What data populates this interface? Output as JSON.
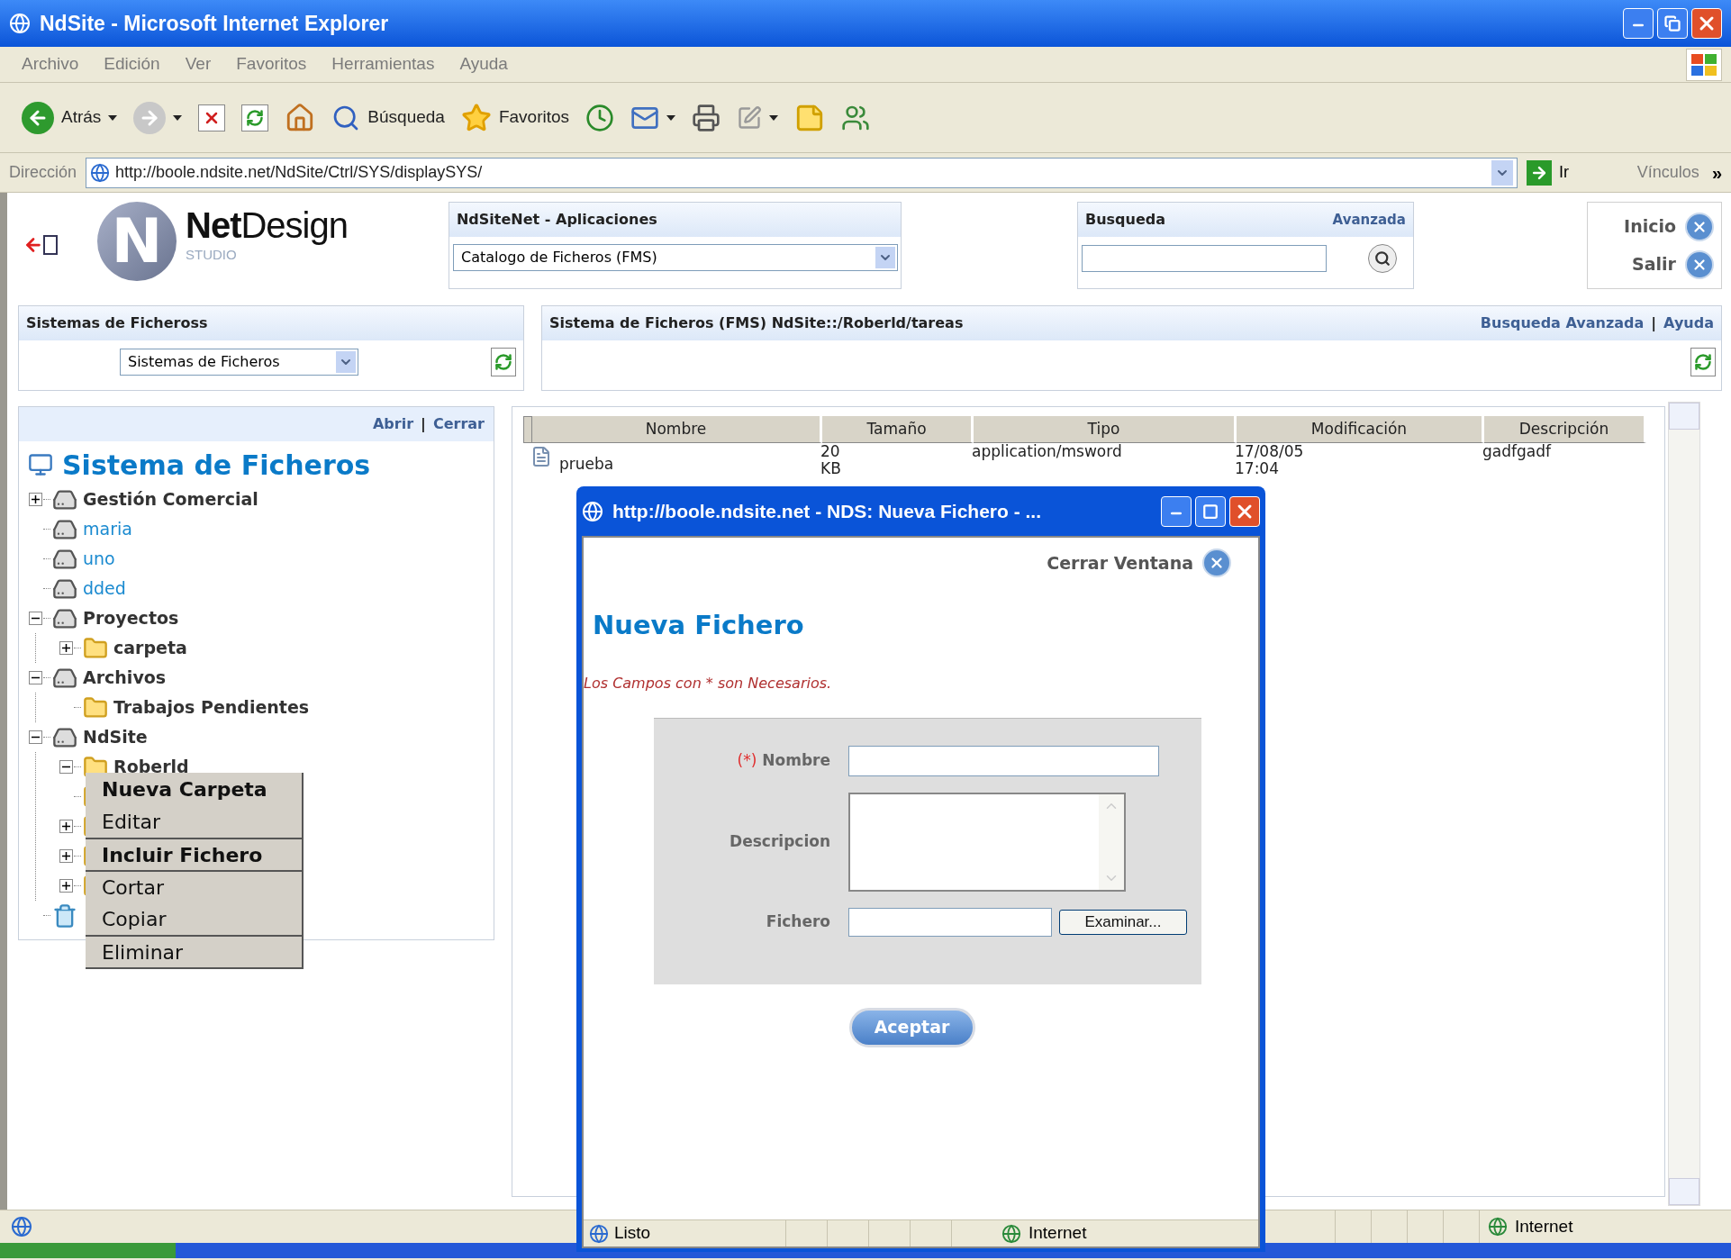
{
  "window": {
    "title": "NdSite - Microsoft Internet Explorer"
  },
  "menu_bar": [
    "Archivo",
    "Edición",
    "Ver",
    "Favoritos",
    "Herramientas",
    "Ayuda"
  ],
  "toolbar": [
    {
      "kind": "back",
      "label": "Atrás",
      "dropdown": true
    },
    {
      "kind": "forward",
      "dropdown": true
    },
    {
      "kind": "stop"
    },
    {
      "kind": "refresh"
    },
    {
      "kind": "home"
    },
    {
      "kind": "search",
      "label": "Búsqueda"
    },
    {
      "kind": "favorites",
      "label": "Favoritos"
    },
    {
      "kind": "history"
    },
    {
      "kind": "mail",
      "dropdown": true
    },
    {
      "kind": "print"
    },
    {
      "kind": "edit",
      "dropdown": true
    },
    {
      "kind": "notes"
    },
    {
      "kind": "messenger"
    }
  ],
  "address_bar": {
    "label": "Dirección",
    "url": "http://boole.ndsite.net/NdSite/Ctrl/SYS/displaySYS/",
    "go": "Ir",
    "links": "Vínculos",
    "more": "»"
  },
  "header": {
    "logo": {
      "mark": "N",
      "name": "**Net**Design",
      "tagline": "STUDIO"
    },
    "applications": {
      "title": "NdSiteNet - Aplicaciones",
      "value": "Catalogo de Ficheros (FMS)"
    },
    "search": {
      "title": "Busqueda",
      "link": "Avanzada"
    },
    "nav": [
      "Inicio",
      "Salir"
    ]
  },
  "filesystems_panel": {
    "title": "Sistemas de Ficheross",
    "value": "Sistemas de Ficheros"
  },
  "path_panel": {
    "title": "Sistema de Ficheros (FMS) NdSite::/Roberld/tareas",
    "links": [
      "Busqueda Avanzada",
      "Ayuda"
    ],
    "link_separator": "|"
  },
  "tree": {
    "links": [
      "Abrir",
      "Cerrar"
    ],
    "link_separator": "|",
    "heading": "Sistema de Ficheros",
    "nodes": [
      {
        "kind": "drive",
        "label": "Gestión Comercial",
        "expanded": false
      },
      {
        "kind": "share",
        "label": "maria"
      },
      {
        "kind": "share",
        "label": "uno"
      },
      {
        "kind": "share",
        "label": "dded"
      },
      {
        "kind": "drive",
        "label": "Proyectos",
        "expanded": true,
        "children": [
          {
            "kind": "folder",
            "label": "carpeta",
            "expanded": false
          }
        ]
      },
      {
        "kind": "drive",
        "label": "Archivos",
        "expanded": true,
        "children": [
          {
            "kind": "folder",
            "label": "Trabajos Pendientes"
          }
        ]
      },
      {
        "kind": "drive",
        "label": "NdSite",
        "expanded": true,
        "children": [
          {
            "kind": "folder",
            "label": "Roberld",
            "expanded": true
          },
          {
            "kind": "folder"
          },
          {
            "kind": "folder",
            "expanded": false
          },
          {
            "kind": "folder",
            "expanded": false
          },
          {
            "kind": "folder",
            "expanded": false
          }
        ]
      },
      {
        "kind": "trash"
      }
    ]
  },
  "table": {
    "columns": [
      "Nombre",
      "Tamaño",
      "Tipo",
      "Modificación",
      "Descripción"
    ],
    "rows": [
      {
        "kind": "file",
        "cells": [
          "prueba",
          "20 KB",
          "application/msword",
          "17/08/05 17:04",
          "gadfgadf"
        ]
      }
    ]
  },
  "context_menu": {
    "items": [
      {
        "label": "Nueva Carpeta",
        "bold": true,
        "separator": false
      },
      {
        "label": "Editar",
        "bold": false,
        "separator": false
      },
      {
        "label": "Incluir Fichero",
        "bold": true,
        "separator": true
      },
      {
        "label": "Cortar",
        "bold": false,
        "separator": true
      },
      {
        "label": "Copiar",
        "bold": false,
        "separator": false
      },
      {
        "label": "Eliminar",
        "bold": false,
        "separator": true
      }
    ]
  },
  "dialog": {
    "title": "http://boole.ndsite.net - NDS: Nueva Fichero - ...",
    "close_link": "Cerrar Ventana",
    "heading": "Nueva Fichero",
    "note": "Los Campos con * son Necesarios.",
    "fields": [
      {
        "kind": "text",
        "label": "Nombre",
        "required_mark": "(*)"
      },
      {
        "kind": "textarea",
        "label": "Descripcion"
      },
      {
        "kind": "file",
        "label": "Fichero",
        "button": "Examinar..."
      }
    ],
    "submit": "Aceptar",
    "status": {
      "text": "Listo",
      "zone": "Internet"
    }
  },
  "status_bar": {
    "zone": "Internet"
  }
}
